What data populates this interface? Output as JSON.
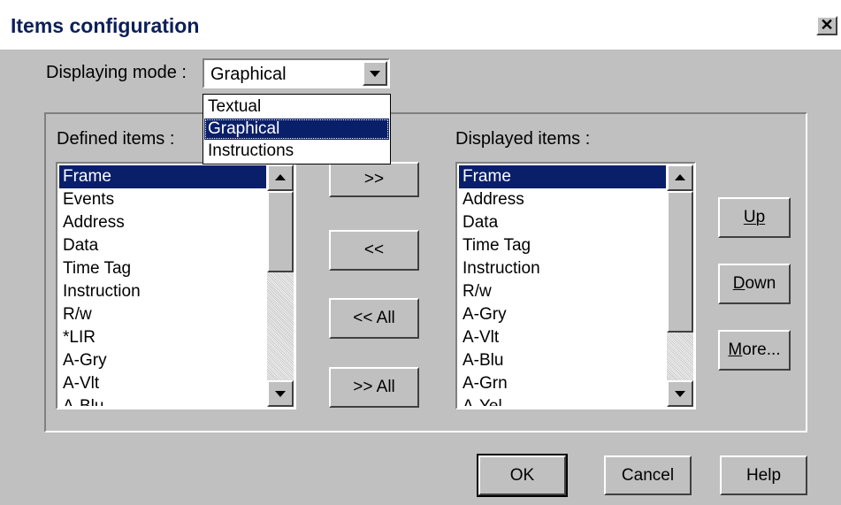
{
  "window": {
    "title": "Items configuration",
    "close_glyph": "✕"
  },
  "mode": {
    "label": "Displaying mode :",
    "value": "Graphical",
    "options": [
      "Textual",
      "Graphical",
      "Instructions"
    ],
    "selected_index": 1
  },
  "defined": {
    "label": "Defined items :",
    "items": [
      "Frame",
      "Events",
      "Address",
      "Data",
      "Time Tag",
      "Instruction",
      "R/w",
      "*LIR",
      "A-Gry",
      "A-Vlt",
      "A-Blu"
    ],
    "selected_index": 0
  },
  "displayed": {
    "label": "Displayed items :",
    "items": [
      "Frame",
      "Address",
      "Data",
      "Time Tag",
      "Instruction",
      "R/w",
      "A-Gry",
      "A-Vlt",
      "A-Blu",
      "A-Grn",
      "A-Yel"
    ],
    "selected_index": 0
  },
  "transfer_buttons": {
    "add": ">>",
    "remove": "<<",
    "remove_all": "<< All",
    "add_all": ">> All"
  },
  "order_buttons": {
    "up": "Up",
    "down": "Down",
    "more": "More..."
  },
  "footer": {
    "ok": "OK",
    "cancel": "Cancel",
    "help": "Help"
  },
  "colors": {
    "selection": "#0a1f6a",
    "face": "#c0c0c0",
    "title_text": "#0b1f5a"
  }
}
